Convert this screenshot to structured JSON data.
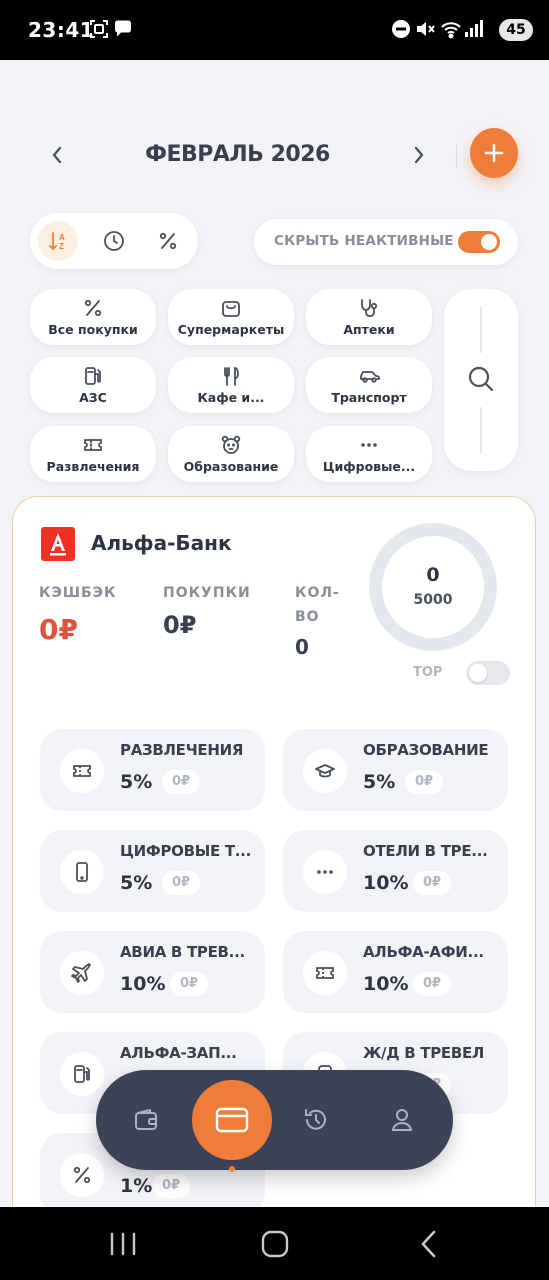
{
  "status_bar": {
    "time": "23:41",
    "battery": "45"
  },
  "header": {
    "month_title": "ФЕВРАЛЬ 2026"
  },
  "filters": {
    "sort_buttons": [
      {
        "icon": "sort-az-icon",
        "active": true
      },
      {
        "icon": "clock-icon",
        "active": false
      },
      {
        "icon": "percent-icon",
        "active": false
      }
    ],
    "hide_inactive_label": "СКРЫТЬ НЕАКТИВНЫЕ",
    "hide_inactive_on": true
  },
  "categories": [
    {
      "label": "Все покупки",
      "icon": "percent-icon"
    },
    {
      "label": "Супермаркеты",
      "icon": "shopping-bag-icon"
    },
    {
      "label": "Аптеки",
      "icon": "stethoscope-icon"
    },
    {
      "label": "АЗС",
      "icon": "fuel-pump-icon"
    },
    {
      "label": "Кафе и...",
      "icon": "cutlery-icon"
    },
    {
      "label": "Транспорт",
      "icon": "car-icon"
    },
    {
      "label": "Развлечения",
      "icon": "ticket-icon"
    },
    {
      "label": "Образование",
      "icon": "bear-icon"
    },
    {
      "label": "Цифровые...",
      "icon": "dots-icon"
    }
  ],
  "bank": {
    "name": "Альфа-Банк",
    "cashback_label": "КЭШБЭК",
    "cashback_value": "0₽",
    "purchases_label": "ПОКУПКИ",
    "purchases_value": "0₽",
    "count_label_1": "КОЛ-",
    "count_label_2": "ВО",
    "count_value": "0",
    "progress_value": "0",
    "progress_max": "5000",
    "top_label": "TOP",
    "top_on": false,
    "accent_color": "#ef3124",
    "cashback_categories": [
      {
        "name": "РАЗВЛЕЧЕНИЯ",
        "percent": "5%",
        "amount": "0₽",
        "icon": "ticket-icon"
      },
      {
        "name": "ОБРАЗОВАНИЕ",
        "percent": "5%",
        "amount": "0₽",
        "icon": "graduation-cap-icon"
      },
      {
        "name": "ЦИФРОВЫЕ Т...",
        "percent": "5%",
        "amount": "0₽",
        "icon": "phone-icon"
      },
      {
        "name": "ОТЕЛИ В ТРЕ...",
        "percent": "10%",
        "amount": "0₽",
        "icon": "dots-icon"
      },
      {
        "name": "АВИА В ТРЕВ...",
        "percent": "10%",
        "amount": "0₽",
        "icon": "plane-icon"
      },
      {
        "name": "АЛЬФА-АФИ...",
        "percent": "10%",
        "amount": "0₽",
        "icon": "ticket-icon"
      },
      {
        "name": "АЛЬФА-ЗАП...",
        "percent": "",
        "amount": "",
        "icon": "fuel-pump-icon"
      },
      {
        "name": "Ж/Д В ТРЕВЕЛ",
        "percent": "",
        "amount": "0₽",
        "icon": "train-icon"
      },
      {
        "name": "",
        "percent": "1%",
        "amount": "0₽",
        "icon": "percent-icon"
      }
    ]
  },
  "bottom_nav": [
    {
      "icon": "wallet-icon",
      "active": false
    },
    {
      "icon": "card-icon",
      "active": true
    },
    {
      "icon": "history-icon",
      "active": false
    },
    {
      "icon": "profile-icon",
      "active": false
    }
  ],
  "colors": {
    "accent": "#ef7d3a",
    "nav_bg": "#3d4356",
    "alfa_red": "#ef3124",
    "cashback_red": "#e0523b"
  }
}
